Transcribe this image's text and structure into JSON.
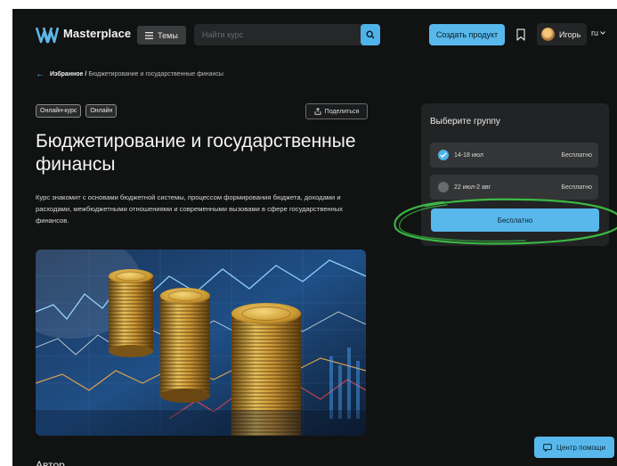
{
  "header": {
    "brand": "Masterplace",
    "themes_label": "Темы",
    "search_placeholder": "Найти курс",
    "create_label": "Создать продукт",
    "user_name": "Игорь",
    "lang": "ru"
  },
  "breadcrumb": {
    "link": "Избранное /",
    "current": "Бюджетирование и государственные финансы"
  },
  "tags": [
    "Онлайн-курс",
    "Онлайн"
  ],
  "share_label": "Поделиться",
  "course": {
    "title": "Бюджетирование и государственные финансы",
    "description": "Курс знакомит с основами бюджетной системы, процессом формирования бюджета, доходами и расходами, межбюджетными отношениями и современными вызовами в сфере государственных финансов."
  },
  "author_heading": "Автор",
  "group_select": {
    "title": "Выберите группу",
    "options": [
      {
        "dates": "14-18 июл",
        "price": "Бесплатно",
        "selected": true
      },
      {
        "dates": "22 июл-2 авг",
        "price": "Бесплатно",
        "selected": false
      }
    ],
    "action_label": "Бесплатно"
  },
  "help_label": "Центр помощи",
  "icons": {
    "logo": "masterplace-logo-icon",
    "menu": "hamburger-menu-icon",
    "search": "search-icon",
    "bookmark": "bookmark-icon",
    "chevron": "chevron-down-icon",
    "share": "share-icon",
    "back": "arrow-left-icon",
    "check": "check-icon",
    "help": "help-chat-icon"
  },
  "colors": {
    "background": "#111212",
    "accent": "#58b8ec",
    "panel": "#222324",
    "annotation": "#3fd24a"
  }
}
